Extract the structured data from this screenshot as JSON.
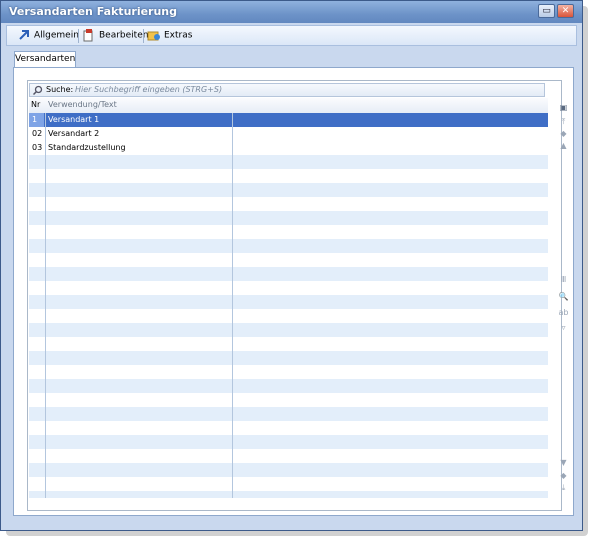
{
  "window": {
    "title": "Versandarten Fakturierung",
    "controls": [
      "restore",
      "close"
    ]
  },
  "toolbar": {
    "items": [
      {
        "label": "Allgemein",
        "icon": "arrow-icon"
      },
      {
        "label": "Bearbeiten",
        "icon": "edit-icon"
      },
      {
        "label": "Extras",
        "icon": "extras-icon"
      }
    ]
  },
  "tabs": [
    {
      "label": "Versandarten"
    }
  ],
  "search": {
    "label": "Suche:",
    "placeholder": "Hier Suchbegriff eingeben (STRG+S)"
  },
  "table": {
    "columns": [
      "Nr",
      "Verwendung/Text"
    ],
    "rows": [
      {
        "nr": "1",
        "text": "Versandart 1",
        "selected": true
      },
      {
        "nr": "02",
        "text": "Versandart 2"
      },
      {
        "nr": "03",
        "text": "Standardzustellung"
      }
    ]
  },
  "colors": {
    "accent": "#3f6ec6",
    "titlebar": "#6d93c8",
    "row_alt": "#e3eefa"
  }
}
